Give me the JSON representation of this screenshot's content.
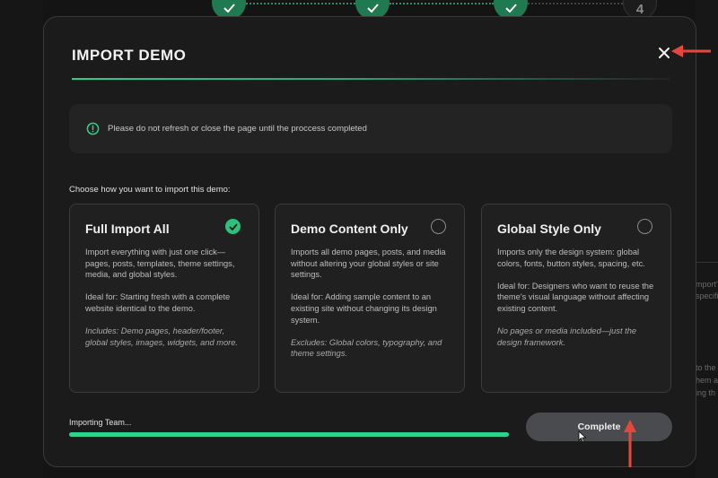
{
  "stepper": {
    "steps": [
      {
        "state": "done"
      },
      {
        "state": "done"
      },
      {
        "state": "done"
      },
      {
        "state": "pending",
        "number": "4"
      }
    ]
  },
  "background_fragments": [
    "mport'",
    "specifi",
    "to the",
    "hem a",
    "ing th"
  ],
  "modal": {
    "title": "IMPORT DEMO",
    "notice": "Please do not refresh or close the page until the proccess completed",
    "choose_label": "Choose how you want to import this demo:",
    "options": [
      {
        "title": "Full Import All",
        "selected": true,
        "description": "Import everything with just one click—pages, posts, templates, theme settings, media, and global styles.",
        "ideal": "Ideal for: Starting fresh with a complete website identical to the demo.",
        "note": "Includes: Demo pages, header/footer, global styles, images, widgets, and more."
      },
      {
        "title": "Demo Content Only",
        "selected": false,
        "description": "Imports all demo pages, posts, and media without altering your global styles or site settings.",
        "ideal": "Ideal for: Adding sample content to an existing site without changing its design system.",
        "note": "Excludes: Global colors, typography, and theme settings."
      },
      {
        "title": "Global Style Only",
        "selected": false,
        "description": "Imports only the design system: global colors, fonts, button styles, spacing, etc.",
        "ideal": "Ideal for: Designers who want to reuse the theme's visual language without affecting existing content.",
        "note": "No pages or media included—just the design framework."
      }
    ],
    "progress": {
      "label": "Importing Team...",
      "fraction": 1.0
    },
    "complete_button": "Complete"
  },
  "colors": {
    "accent": "#2bd38f",
    "annotation_arrow": "#e5483b"
  },
  "icons": [
    "check-icon",
    "close-icon",
    "alert-circle-icon",
    "cursor-icon",
    "arrow-icon"
  ]
}
